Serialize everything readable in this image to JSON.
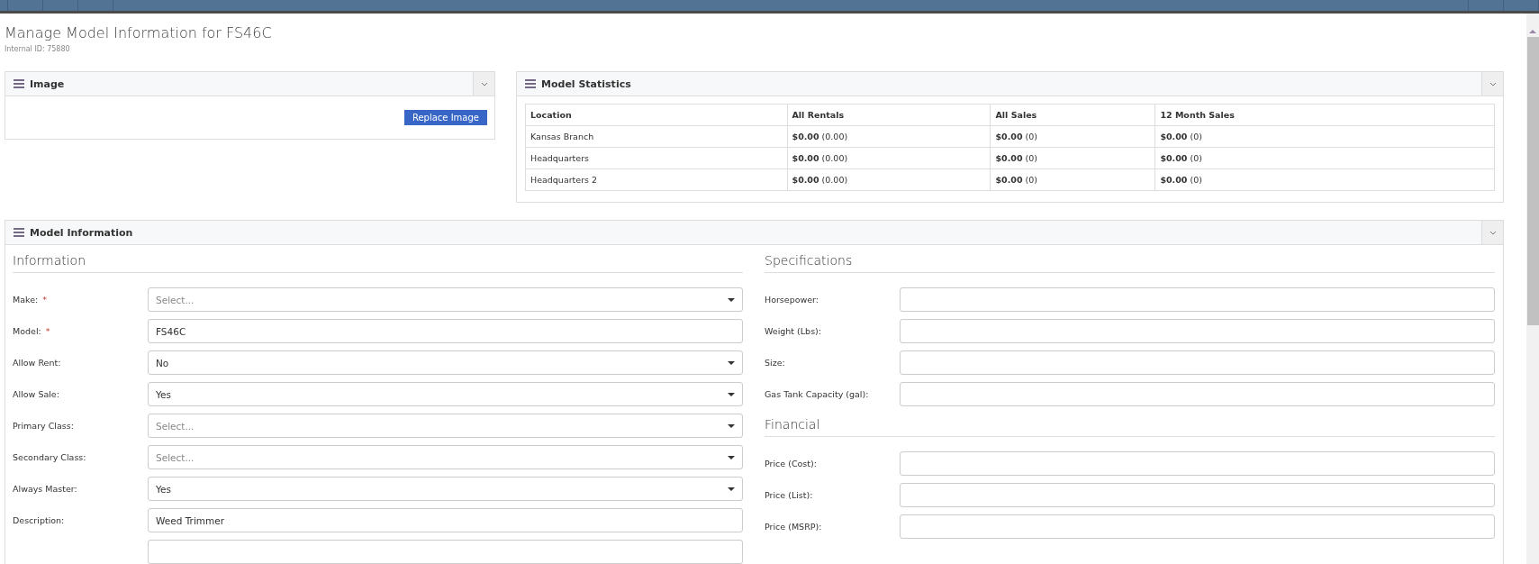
{
  "page": {
    "title": "Manage Model Information for FS46C",
    "subtitle": "Internal ID: 75880"
  },
  "image_panel": {
    "title": "Image",
    "button": "Replace Image"
  },
  "stats_panel": {
    "title": "Model Statistics",
    "columns": [
      "Location",
      "All Rentals",
      "All Sales",
      "12 Month Sales"
    ],
    "rows": [
      [
        "Kansas Branch",
        "**$0.00** (0.00)",
        "**$0.00** (0)",
        "**$0.00** (0)"
      ],
      [
        "Headquarters",
        "**$0.00** (0.00)",
        "**$0.00** (0)",
        "**$0.00** (0)"
      ],
      [
        "Headquarters 2",
        "**$0.00** (0.00)",
        "**$0.00** (0)",
        "**$0.00** (0)"
      ]
    ]
  },
  "info_panel": {
    "title": "Model Information",
    "sections": [
      {
        "heading": "Information",
        "fields": [
          {
            "label": "Make:",
            "required_mark": "*",
            "kind": "select",
            "placeholder": "Select..."
          },
          {
            "label": "Model:",
            "required_mark": "*",
            "kind": "text",
            "value": "FS46C"
          },
          {
            "label": "Allow Rent:",
            "kind": "select",
            "value": "No"
          },
          {
            "label": "Allow Sale:",
            "kind": "select",
            "value": "Yes"
          },
          {
            "label": "Primary Class:",
            "kind": "select",
            "placeholder": "Select..."
          },
          {
            "label": "Secondary Class:",
            "kind": "select",
            "placeholder": "Select..."
          },
          {
            "label": "Always Master:",
            "kind": "select",
            "value": "Yes"
          },
          {
            "label": "Description:",
            "kind": "text",
            "value": "Weed Trimmer"
          },
          {
            "kind": "text"
          }
        ]
      },
      {
        "heading": "Specifications",
        "fields": [
          {
            "label": "Horsepower:",
            "kind": "text"
          },
          {
            "label": "Weight (Lbs):",
            "kind": "text"
          },
          {
            "label": "Size:",
            "kind": "text"
          },
          {
            "label": "Gas Tank Capacity (gal):",
            "kind": "text"
          }
        ]
      },
      {
        "heading": "Financial",
        "fields": [
          {
            "label": "Price (Cost):",
            "kind": "text"
          },
          {
            "label": "Price (List):",
            "kind": "text"
          },
          {
            "label": "Price (MSRP):",
            "kind": "text"
          }
        ]
      }
    ]
  }
}
